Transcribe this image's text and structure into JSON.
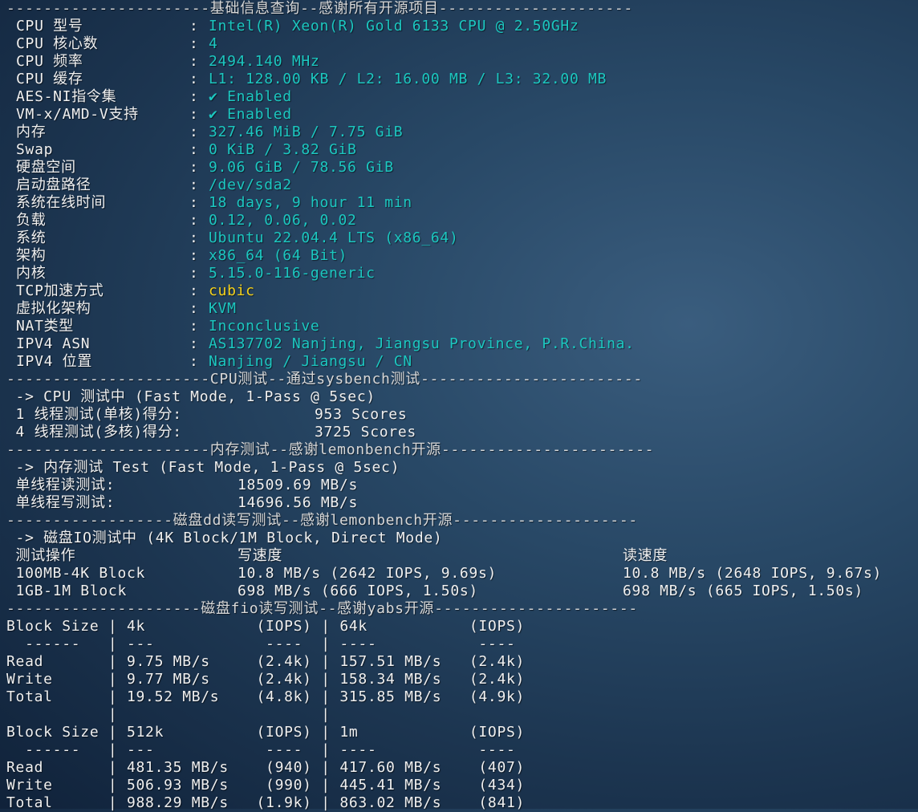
{
  "colors": {
    "accent": "#1cc7c0",
    "highlight": "#f5d21a",
    "text": "#f0f0f0",
    "background": "#1c3550"
  },
  "sections": {
    "basic": "----------------------基础信息查询--感谢所有开源项目---------------------",
    "cpu": "----------------------CPU测试--通过sysbench测试------------------------",
    "mem": "----------------------内存测试--感谢lemonbench开源-----------------------",
    "disk_dd": "------------------磁盘dd读写测试--感谢lemonbench开源--------------------",
    "disk_fio": "---------------------磁盘fio读写测试--感谢yabs开源----------------------"
  },
  "sysinfo": [
    {
      "label": "CPU 型号",
      "value": "Intel(R) Xeon(R) Gold 6133 CPU @ 2.50GHz"
    },
    {
      "label": "CPU 核心数",
      "value": "4"
    },
    {
      "label": "CPU 频率",
      "value": "2494.140 MHz"
    },
    {
      "label": "CPU 缓存",
      "value": "L1: 128.00 KB / L2: 16.00 MB / L3: 32.00 MB"
    },
    {
      "label": "AES-NI指令集",
      "value": "✔ Enabled"
    },
    {
      "label": "VM-x/AMD-V支持",
      "value": "✔ Enabled"
    },
    {
      "label": "内存",
      "value": "327.46 MiB / 7.75 GiB"
    },
    {
      "label": "Swap",
      "value": "0 KiB / 3.82 GiB"
    },
    {
      "label": "硬盘空间",
      "value": "9.06 GiB / 78.56 GiB"
    },
    {
      "label": "启动盘路径",
      "value": "/dev/sda2"
    },
    {
      "label": "系统在线时间",
      "value": "18 days, 9 hour 11 min"
    },
    {
      "label": "负载",
      "value": "0.12, 0.06, 0.02"
    },
    {
      "label": "系统",
      "value": "Ubuntu 22.04.4 LTS (x86_64)"
    },
    {
      "label": "架构",
      "value": "x86_64 (64 Bit)"
    },
    {
      "label": "内核",
      "value": "5.15.0-116-generic"
    },
    {
      "label": "TCP加速方式",
      "value": "cubic"
    },
    {
      "label": "虚拟化架构",
      "value": "KVM"
    },
    {
      "label": "NAT类型",
      "value": "Inconclusive"
    },
    {
      "label": "IPV4 ASN",
      "value": "AS137702 Nanjing, Jiangsu Province, P.R.China."
    },
    {
      "label": "IPV4 位置",
      "value": "Nanjing / Jiangsu / CN"
    }
  ],
  "separator": ":",
  "cpu": {
    "mode": " -> CPU 测试中 (Fast Mode, 1-Pass @ 5sec)",
    "single_label": " 1 线程测试(单核)得分:",
    "single_value": "953 Scores",
    "multi_label": " 4 线程测试(多核)得分:",
    "multi_value": "3725 Scores"
  },
  "mem": {
    "mode": " -> 内存测试 Test (Fast Mode, 1-Pass @ 5sec)",
    "read_label": " 单线程读测试:",
    "read_value": "18509.69 MB/s",
    "write_label": " 单线程写测试:",
    "write_value": "14696.56 MB/s"
  },
  "dd": {
    "mode": " -> 磁盘IO测试中 (4K Block/1M Block, Direct Mode)",
    "headers": [
      " 测试操作",
      "写速度",
      "读速度"
    ],
    "rows": [
      {
        "op": " 100MB-4K Block",
        "write": "10.8 MB/s (2642 IOPS, 9.69s)",
        "read": "10.8 MB/s (2648 IOPS, 9.67s)"
      },
      {
        "op": " 1GB-1M Block",
        "write": "698 MB/s (666 IOPS, 1.50s)",
        "read": "698 MB/s (665 IOPS, 1.50s)"
      }
    ]
  },
  "fio": [
    "Block Size | 4k            (IOPS) | 64k           (IOPS)",
    "  ------   | ---            ----  | ----           ----",
    "Read       | 9.75 MB/s     (2.4k) | 157.51 MB/s   (2.4k)",
    "Write      | 9.77 MB/s     (2.4k) | 158.34 MB/s   (2.4k)",
    "Total      | 19.52 MB/s    (4.8k) | 315.85 MB/s   (4.9k)",
    "           |                      |",
    "Block Size | 512k          (IOPS) | 1m            (IOPS)",
    "  ------   | ---            ----  | ----           ----",
    "Read       | 481.35 MB/s    (940) | 417.60 MB/s    (407)",
    "Write      | 506.93 MB/s    (990) | 445.41 MB/s    (434)",
    "Total      | 988.29 MB/s   (1.9k) | 863.02 MB/s    (841)"
  ]
}
